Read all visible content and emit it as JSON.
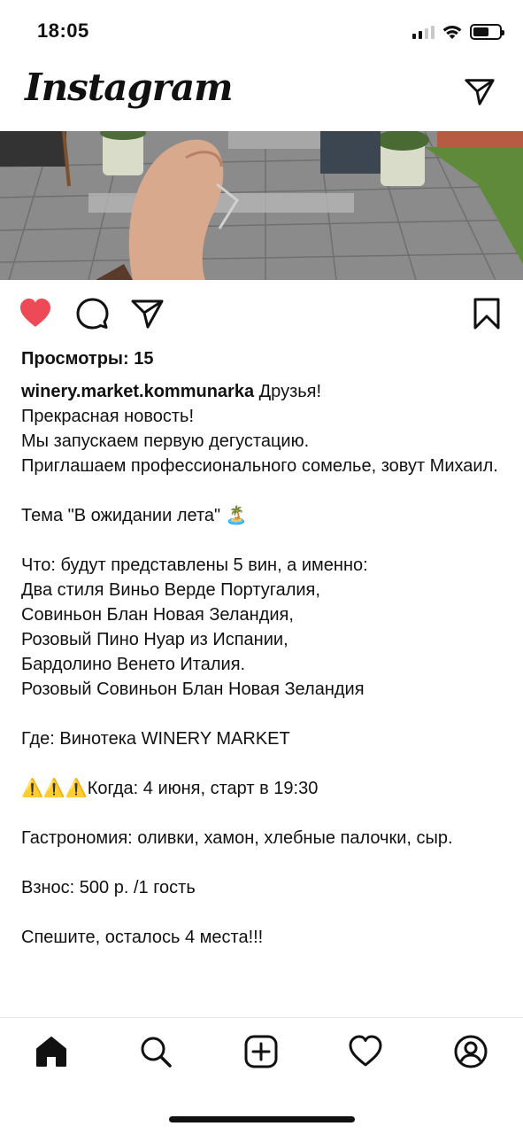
{
  "status_bar": {
    "time": "18:05"
  },
  "header": {
    "logo": "Instagram",
    "direct_icon": "paper-plane-icon"
  },
  "post": {
    "liked": true,
    "like_color": "#ed4956",
    "views_label": "Просмотры: 15",
    "username": "winery.market.kommunarka",
    "caption_first": " Друзья!",
    "caption_lines": [
      "Прекрасная новость!",
      "Мы запускаем первую дегустацию.",
      "Приглашаем профессионального сомелье, зовут Михаил.",
      "",
      "Тема \"В ожидании лета\" 🏝️",
      "",
      "Что: будут представлены 5 вин, а именно:",
      "Два стиля Виньо Верде Португалия,",
      "Совиньон Блан Новая Зеландия,",
      "Розовый Пино Нуар из Испании,",
      "Бардолино Венето Италия.",
      "Розовый Совиньон Блан Новая Зеландия",
      "",
      "Где: Винотека WINERY MARKET",
      "",
      "⚠️⚠️⚠️Когда: 4 июня, старт в 19:30",
      "",
      "Гастрономия: оливки, хамон, хлебные палочки, сыр.",
      "",
      "Взнос: 500 р. /1 гость",
      "",
      "Спешите, осталось 4 места!!!"
    ]
  },
  "bottom_nav": {
    "items": [
      "home-icon",
      "search-icon",
      "new-post-icon",
      "activity-heart-icon",
      "profile-icon"
    ]
  }
}
